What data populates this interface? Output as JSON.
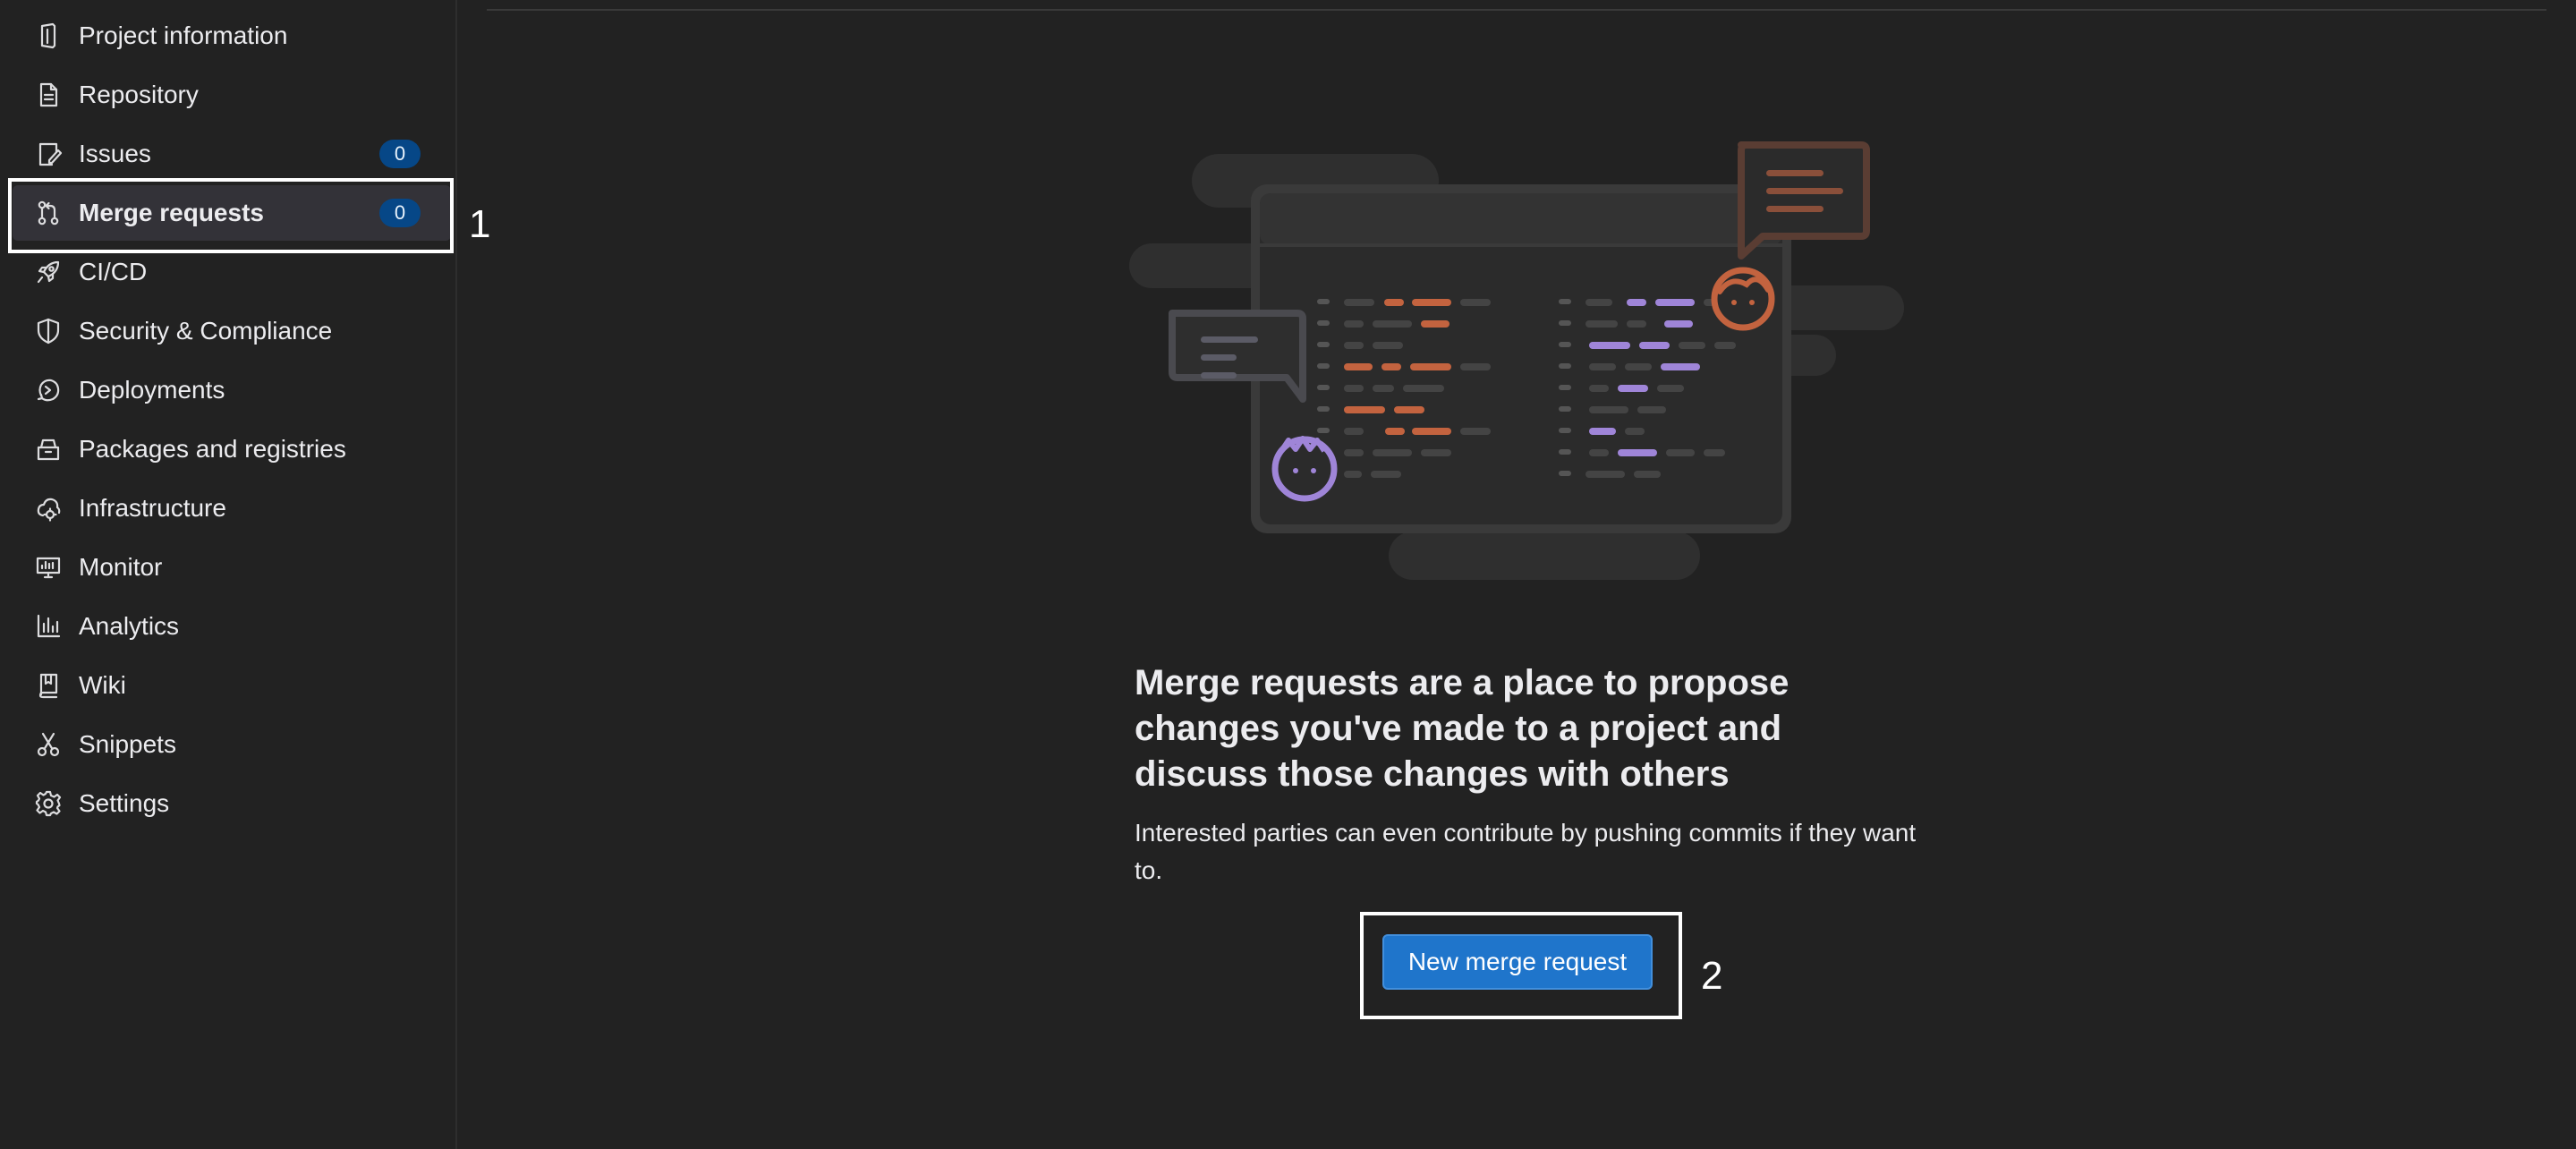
{
  "sidebar": {
    "items": [
      {
        "label": "Project information",
        "icon": "project-icon"
      },
      {
        "label": "Repository",
        "icon": "doc-icon"
      },
      {
        "label": "Issues",
        "icon": "issues-icon",
        "badge": "0"
      },
      {
        "label": "Merge requests",
        "icon": "git-merge-icon",
        "badge": "0",
        "active": true
      },
      {
        "label": "CI/CD",
        "icon": "rocket-icon"
      },
      {
        "label": "Security & Compliance",
        "icon": "shield-icon"
      },
      {
        "label": "Deployments",
        "icon": "deployments-icon"
      },
      {
        "label": "Packages and registries",
        "icon": "package-icon"
      },
      {
        "label": "Infrastructure",
        "icon": "cloud-gear-icon"
      },
      {
        "label": "Monitor",
        "icon": "monitor-icon"
      },
      {
        "label": "Analytics",
        "icon": "chart-icon"
      },
      {
        "label": "Wiki",
        "icon": "book-icon"
      },
      {
        "label": "Snippets",
        "icon": "scissors-icon"
      },
      {
        "label": "Settings",
        "icon": "gear-icon"
      }
    ]
  },
  "empty_state": {
    "title": "Merge requests are a place to propose changes you've made to a project and discuss those changes with others",
    "description": "Interested parties can even contribute by pushing commits if they want to.",
    "button_label": "New merge request"
  },
  "annotations": {
    "first": "1",
    "second": "2"
  },
  "colors": {
    "background": "#222222",
    "badge": "#064787",
    "button": "#1f75cb",
    "orange_accent": "#c3633f",
    "purple_accent": "#9f85d8"
  }
}
